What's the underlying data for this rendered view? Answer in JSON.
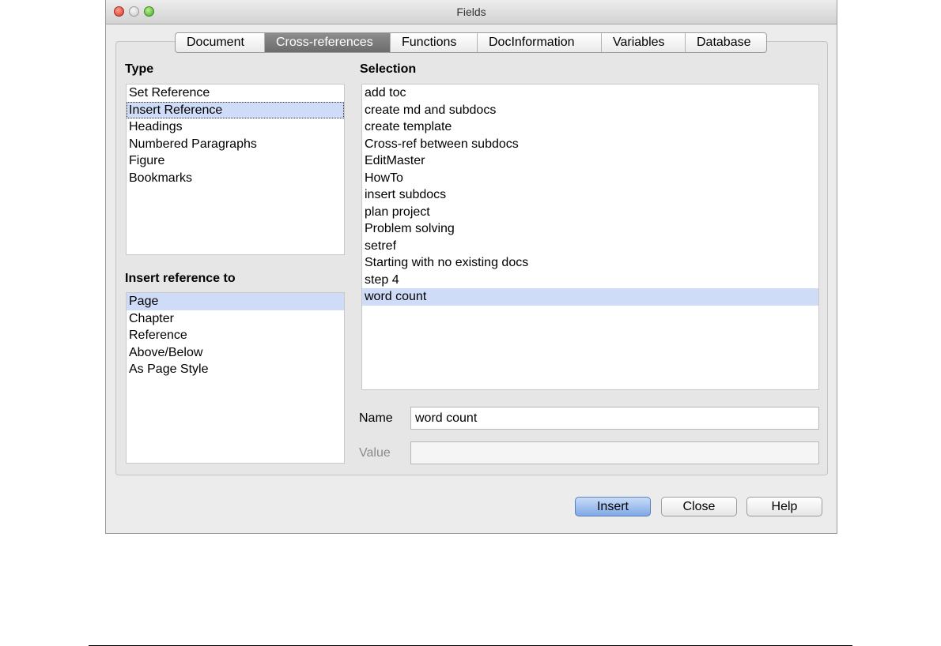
{
  "window": {
    "title": "Fields"
  },
  "tabs": [
    "Document",
    "Cross-references",
    "Functions",
    "DocInformation",
    "Variables",
    "Database"
  ],
  "type_section": {
    "label": "Type",
    "items": [
      "Set Reference",
      "Insert Reference",
      "Headings",
      "Numbered Paragraphs",
      "Figure",
      "Bookmarks"
    ]
  },
  "insert_ref_section": {
    "label": "Insert reference to",
    "items": [
      "Page",
      "Chapter",
      "Reference",
      "Above/Below",
      "As Page Style"
    ]
  },
  "selection_section": {
    "label": "Selection",
    "items": [
      "add toc",
      "create md and subdocs",
      "create template",
      "Cross-ref between subdocs",
      "EditMaster",
      "HowTo",
      "insert subdocs",
      "plan project",
      "Problem solving",
      "setref",
      "Starting with no existing docs",
      "step 4",
      "word count"
    ]
  },
  "name_field": {
    "label": "Name",
    "value": "word count"
  },
  "value_field": {
    "label": "Value",
    "value": ""
  },
  "buttons": {
    "insert": "Insert",
    "close": "Close",
    "help": "Help"
  },
  "colors": {
    "selection_highlight": "#cfdcf7",
    "active_tab": "#7a7a7a",
    "default_button": "#8fb3ea"
  }
}
